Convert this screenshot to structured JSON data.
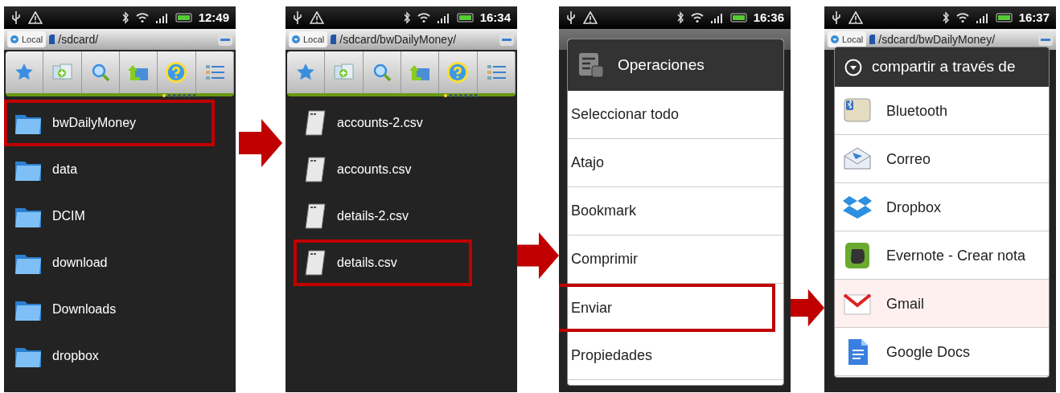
{
  "screens": [
    {
      "kind": "browser",
      "time": "12:49",
      "location": {
        "source": "Local",
        "path": "/sdcard/"
      },
      "files": [
        {
          "name": "bwDailyMoney",
          "kind": "folder",
          "highlighted": true
        },
        {
          "name": "data",
          "kind": "folder",
          "highlighted": false
        },
        {
          "name": "DCIM",
          "kind": "folder",
          "highlighted": false
        },
        {
          "name": "download",
          "kind": "folder",
          "highlighted": false
        },
        {
          "name": "Downloads",
          "kind": "folder",
          "highlighted": false
        },
        {
          "name": "dropbox",
          "kind": "folder",
          "highlighted": false
        }
      ]
    },
    {
      "kind": "browser",
      "time": "16:34",
      "location": {
        "source": "Local",
        "path": "/sdcard/bwDailyMoney/"
      },
      "files": [
        {
          "name": "accounts-2.csv",
          "kind": "file",
          "highlighted": false
        },
        {
          "name": "accounts.csv",
          "kind": "file",
          "highlighted": false
        },
        {
          "name": "details-2.csv",
          "kind": "file",
          "highlighted": false
        },
        {
          "name": "details.csv",
          "kind": "file",
          "highlighted": true
        }
      ]
    },
    {
      "kind": "menu",
      "time": "16:36",
      "title": "Operaciones",
      "items": [
        {
          "label": "Seleccionar todo",
          "highlighted": false
        },
        {
          "label": "Atajo",
          "highlighted": false
        },
        {
          "label": "Bookmark",
          "highlighted": false
        },
        {
          "label": "Comprimir",
          "highlighted": false
        },
        {
          "label": "Enviar",
          "highlighted": true
        },
        {
          "label": "Propiedades",
          "highlighted": false
        }
      ]
    },
    {
      "kind": "share",
      "time": "16:37",
      "location": {
        "source": "Local",
        "path": "/sdcard/bwDailyMoney/"
      },
      "title": "compartir a través de",
      "items": [
        {
          "label": "Bluetooth",
          "kind": "bluetooth",
          "highlighted": false
        },
        {
          "label": "Correo",
          "kind": "mail",
          "highlighted": false
        },
        {
          "label": "Dropbox",
          "kind": "box",
          "highlighted": false
        },
        {
          "label": "Evernote - Crear nota",
          "kind": "elephant",
          "highlighted": false
        },
        {
          "label": "Gmail",
          "kind": "gmail",
          "highlighted": true
        },
        {
          "label": "Google Docs",
          "kind": "docs",
          "highlighted": false
        }
      ]
    }
  ]
}
